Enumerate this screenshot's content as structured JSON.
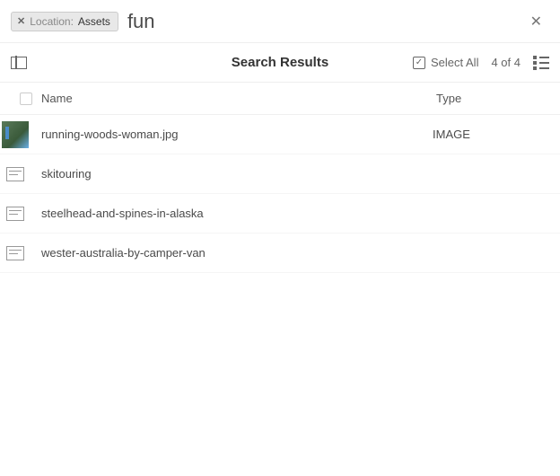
{
  "search": {
    "filter": {
      "label": "Location:",
      "value": "Assets"
    },
    "query": "fun"
  },
  "toolbar": {
    "title": "Search Results",
    "selectAll": "Select All",
    "count": "4 of 4"
  },
  "columns": {
    "name": "Name",
    "type": "Type"
  },
  "results": [
    {
      "name": "running-woods-woman.jpg",
      "type": "IMAGE",
      "thumb": "image"
    },
    {
      "name": "skitouring",
      "type": "",
      "thumb": "fragment"
    },
    {
      "name": "steelhead-and-spines-in-alaska",
      "type": "",
      "thumb": "fragment"
    },
    {
      "name": "wester-australia-by-camper-van",
      "type": "",
      "thumb": "fragment"
    }
  ]
}
